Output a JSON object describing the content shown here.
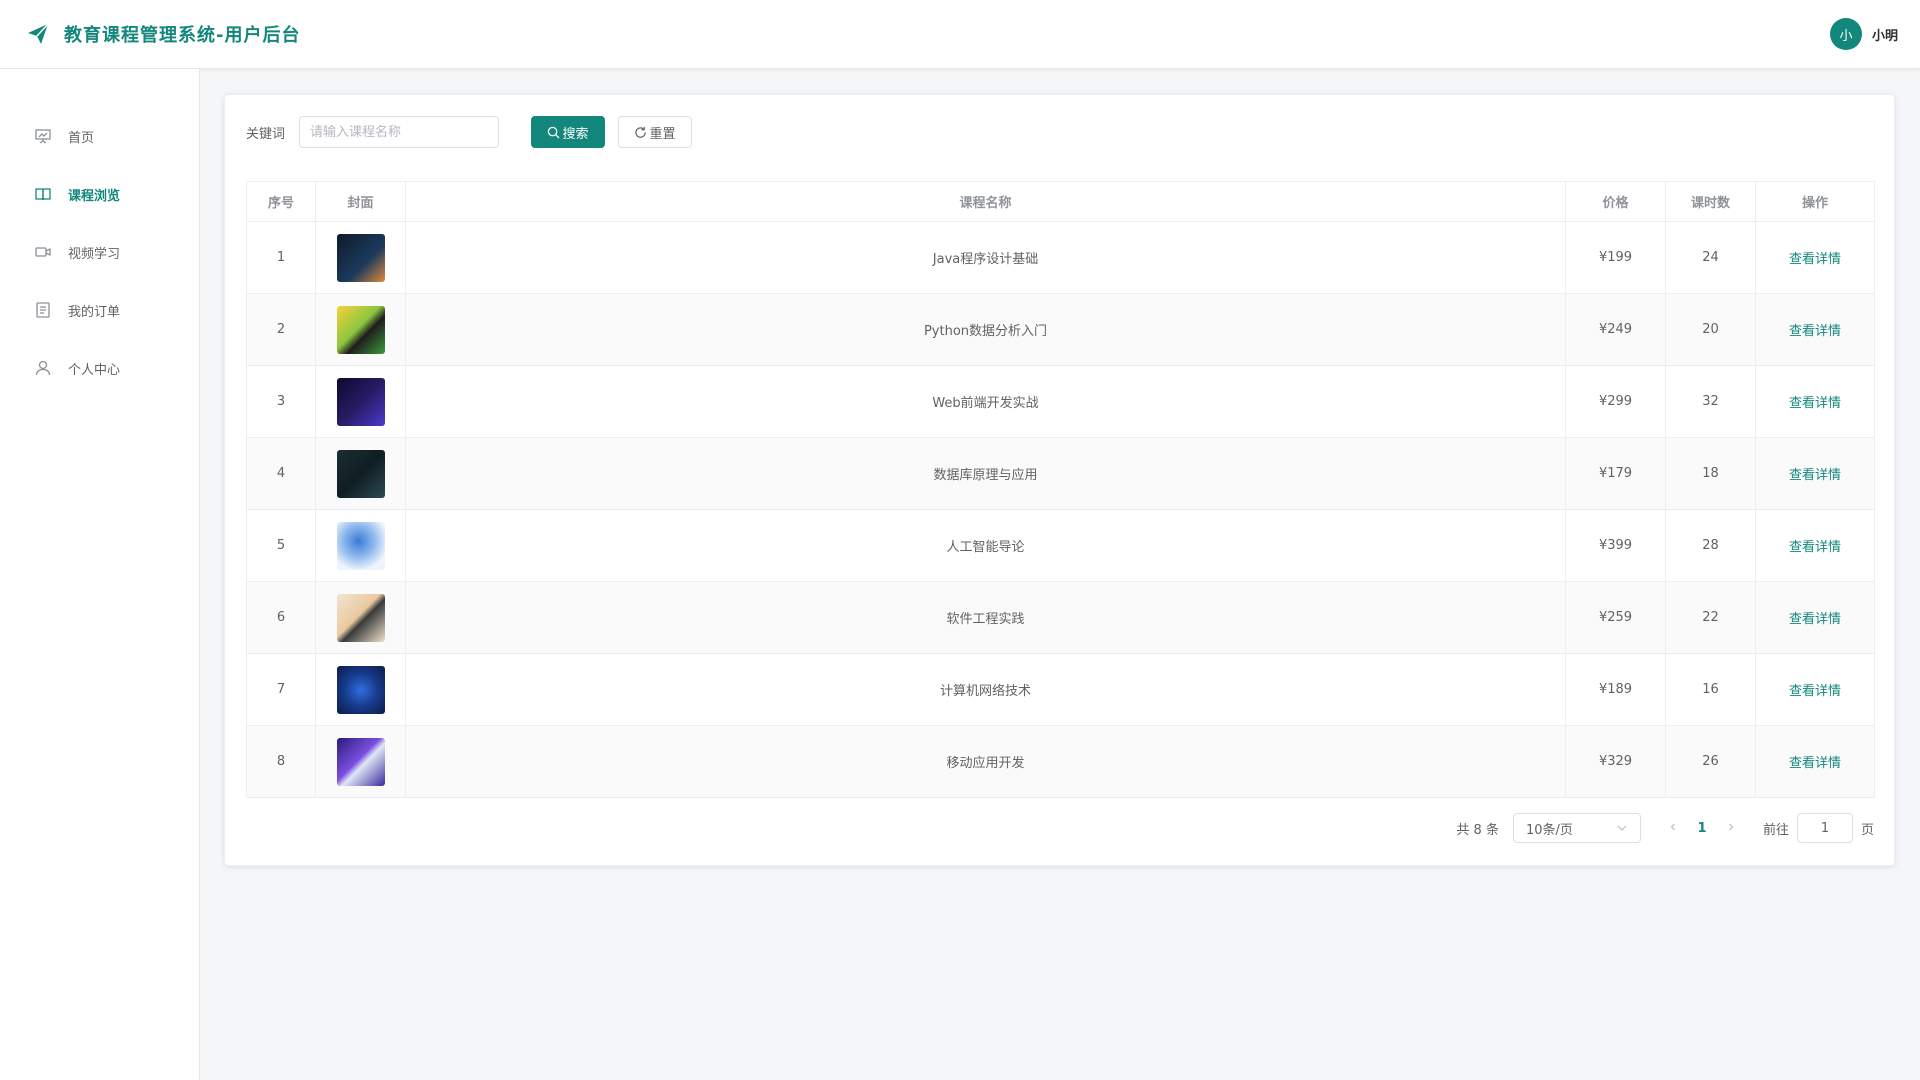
{
  "header": {
    "title": "教育课程管理系统-用户后台",
    "user": {
      "avatar_text": "小",
      "name": "小明"
    }
  },
  "sidebar": {
    "items": [
      {
        "label": "首页",
        "icon": "presentation-icon",
        "active": false
      },
      {
        "label": "课程浏览",
        "icon": "book-icon",
        "active": true
      },
      {
        "label": "视频学习",
        "icon": "video-icon",
        "active": false
      },
      {
        "label": "我的订单",
        "icon": "document-icon",
        "active": false
      },
      {
        "label": "个人中心",
        "icon": "user-icon",
        "active": false
      }
    ]
  },
  "search": {
    "label": "关键词",
    "placeholder": "请输入课程名称",
    "value": "",
    "search_button": "搜索",
    "reset_button": "重置"
  },
  "table": {
    "columns": [
      "序号",
      "封面",
      "课程名称",
      "价格",
      "课时数",
      "操作"
    ],
    "action_label": "查看详情",
    "rows": [
      {
        "index": "1",
        "name": "Java程序设计基础",
        "price": "¥199",
        "hours": "24"
      },
      {
        "index": "2",
        "name": "Python数据分析入门",
        "price": "¥249",
        "hours": "20"
      },
      {
        "index": "3",
        "name": "Web前端开发实战",
        "price": "¥299",
        "hours": "32"
      },
      {
        "index": "4",
        "name": "数据库原理与应用",
        "price": "¥179",
        "hours": "18"
      },
      {
        "index": "5",
        "name": "人工智能导论",
        "price": "¥399",
        "hours": "28"
      },
      {
        "index": "6",
        "name": "软件工程实践",
        "price": "¥259",
        "hours": "22"
      },
      {
        "index": "7",
        "name": "计算机网络技术",
        "price": "¥189",
        "hours": "16"
      },
      {
        "index": "8",
        "name": "移动应用开发",
        "price": "¥329",
        "hours": "26"
      }
    ]
  },
  "pagination": {
    "total": "共 8 条",
    "page_size": "10条/页",
    "current_page": "1",
    "goto_label": "前往",
    "goto_value": "1",
    "page_suffix": "页"
  },
  "colors": {
    "accent": "#13877c"
  }
}
